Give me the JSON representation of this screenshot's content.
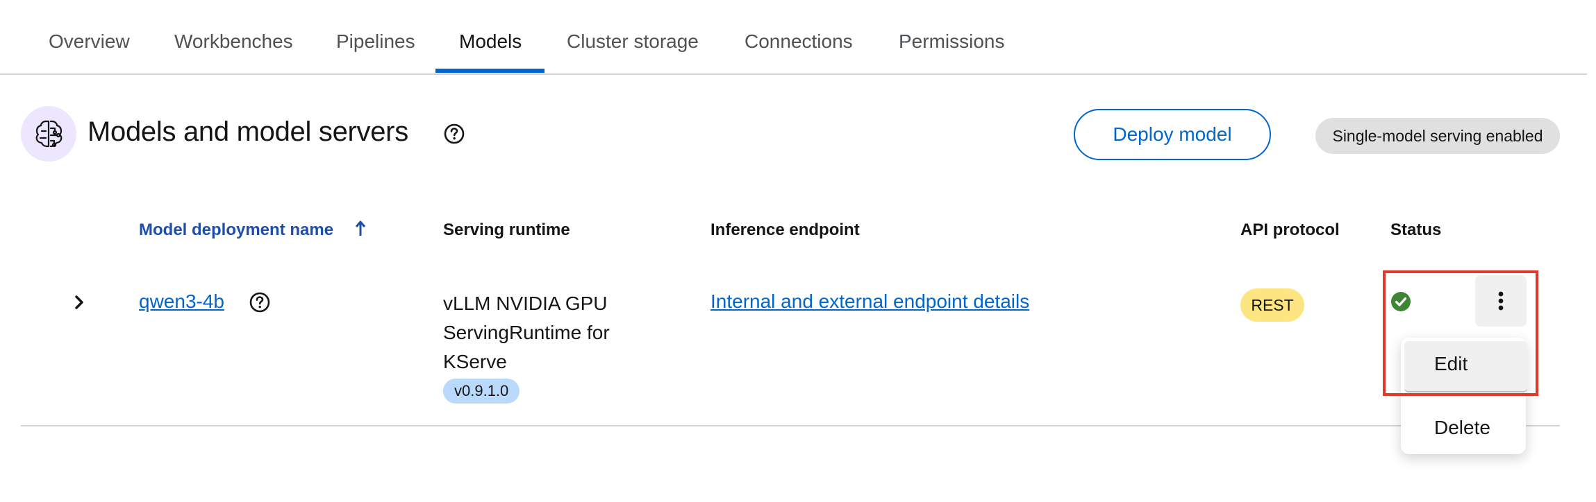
{
  "tabs": [
    {
      "label": "Overview"
    },
    {
      "label": "Workbenches"
    },
    {
      "label": "Pipelines"
    },
    {
      "label": "Models",
      "active": true
    },
    {
      "label": "Cluster storage"
    },
    {
      "label": "Connections"
    },
    {
      "label": "Permissions"
    }
  ],
  "header": {
    "icon": "brain-circuit-icon",
    "title": "Models and model servers",
    "help_icon": "help-icon",
    "deploy_label": "Deploy model",
    "serving_badge": "Single-model serving enabled"
  },
  "table": {
    "columns": {
      "name": "Model deployment name",
      "runtime": "Serving runtime",
      "endpoint": "Inference endpoint",
      "api": "API protocol",
      "status": "Status"
    },
    "sort_icon": "arrow-up-icon",
    "rows": [
      {
        "name": "qwen3-4b",
        "runtime_line1": "vLLM NVIDIA GPU",
        "runtime_line2": "ServingRuntime for",
        "runtime_line3": "KServe",
        "version": "v0.9.1.0",
        "endpoint": "Internal and external endpoint details",
        "api_protocol": "REST",
        "status_icon": "check-circle-icon",
        "status": "success"
      }
    ]
  },
  "menu": {
    "edit": "Edit",
    "delete": "Delete"
  },
  "colors": {
    "accent": "#0066cc",
    "success": "#3e8635",
    "highlight": "#e03a2f",
    "rest_badge": "#fde682",
    "version_badge": "#b9dafc"
  }
}
